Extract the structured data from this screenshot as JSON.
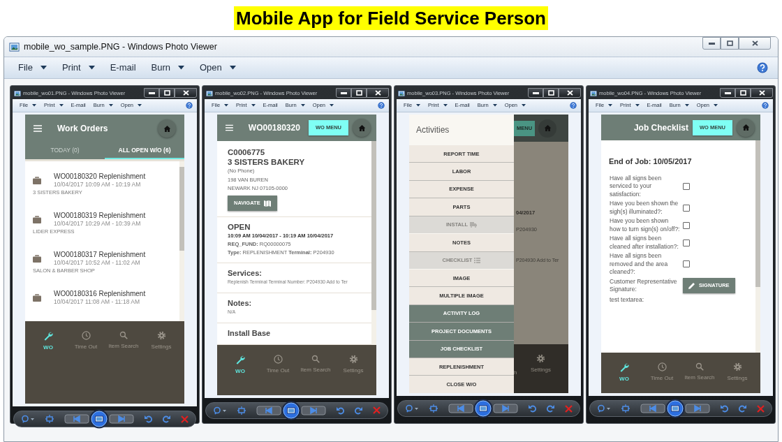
{
  "banner": "Mobile App for Field Service Person",
  "window": {
    "title": "mobile_wo_sample.PNG - Windows Photo Viewer"
  },
  "menu": [
    {
      "label": "File",
      "dropdown": true
    },
    {
      "label": "Print",
      "dropdown": true
    },
    {
      "label": "E-mail",
      "dropdown": false
    },
    {
      "label": "Burn",
      "dropdown": true
    },
    {
      "label": "Open",
      "dropdown": true
    }
  ],
  "viewers": [
    {
      "title": "mobile_wo01.PNG - Windows Photo Viewer",
      "menu": [
        {
          "label": "File",
          "dropdown": true
        },
        {
          "label": "Print",
          "dropdown": true
        },
        {
          "label": "E-mail",
          "dropdown": false
        },
        {
          "label": "Burn",
          "dropdown": true
        },
        {
          "label": "Open",
          "dropdown": true
        }
      ],
      "screen": {
        "kind": "work_orders",
        "title": "Work Orders",
        "tabs": [
          {
            "label": "TODAY (0)",
            "selected": false
          },
          {
            "label": "ALL OPEN W/O (6)",
            "selected": true
          }
        ],
        "orders": [
          {
            "title": "WO00180320 Replenishment",
            "time": "10/04/2017 10:09 AM - 10:19 AM",
            "customer": "3 SISTERS BAKERY"
          },
          {
            "title": "WO00180319 Replenishment",
            "time": "10/04/2017 10:29 AM - 10:39 AM",
            "customer": "LIDER EXPRESS"
          },
          {
            "title": "WO00180317 Replenishment",
            "time": "10/04/2017 10:52 AM - 11:02 AM",
            "customer": "SALON & BARBER SHOP"
          },
          {
            "title": "WO00180316 Replenishment",
            "time": "10/04/2017 11:08 AM - 11:18 AM"
          }
        ],
        "nav": [
          {
            "label": "WO",
            "selected": true
          },
          {
            "label": "Time Out",
            "selected": false
          },
          {
            "label": "Item Search",
            "selected": false
          },
          {
            "label": "Settings",
            "selected": false
          }
        ]
      }
    },
    {
      "title": "mobile_wo02.PNG - Windows Photo Viewer",
      "menu": [
        {
          "label": "File",
          "dropdown": true
        },
        {
          "label": "Print",
          "dropdown": true
        },
        {
          "label": "E-mail",
          "dropdown": false
        },
        {
          "label": "Burn",
          "dropdown": true
        },
        {
          "label": "Open",
          "dropdown": true
        }
      ],
      "screen": {
        "kind": "wo_detail",
        "title": "WO00180320",
        "menu_button": "WO MENU",
        "customer": {
          "id": "C0006775",
          "name": "3 SISTERS BAKERY",
          "lines": [
            "(No Phone)",
            "198 VAN BUREN",
            "NEWARK NJ 07105-0000"
          ],
          "navigate": "NAVIGATE"
        },
        "status": {
          "heading": "OPEN",
          "time": "10:09 AM 10/04/2017 - 10:19 AM 10/04/2017",
          "fund": "**REQ_FUND:** RQ00000075",
          "type": "**Type:** REPLENISHMENT **Terminal:** P204930"
        },
        "sections": [
          {
            "heading": "Services:",
            "text": "Replenish Terminal Terminal Number: P204930 Add to Ter"
          },
          {
            "heading": "Notes:",
            "text": "N/A"
          },
          {
            "heading": "Install Base"
          }
        ],
        "nav": [
          {
            "label": "WO",
            "selected": true
          },
          {
            "label": "Time Out",
            "selected": false
          },
          {
            "label": "Item Search",
            "selected": false
          },
          {
            "label": "Settings",
            "selected": false
          }
        ]
      }
    },
    {
      "title": "mobile_wo03.PNG - Windows Photo Viewer",
      "menu": [
        {
          "label": "File",
          "dropdown": true
        },
        {
          "label": "Print",
          "dropdown": true
        },
        {
          "label": "E-mail",
          "dropdown": false
        },
        {
          "label": "Burn",
          "dropdown": true
        },
        {
          "label": "Open",
          "dropdown": true
        }
      ],
      "screen": {
        "kind": "activities",
        "drawer_title": "Activities",
        "actions": [
          {
            "label": "REPORT TIME",
            "kind": "normal"
          },
          {
            "label": "LABOR",
            "kind": "normal"
          },
          {
            "label": "EXPENSE",
            "kind": "normal"
          },
          {
            "label": "PARTS",
            "kind": "normal"
          },
          {
            "label": "INSTALL",
            "kind": "disabled"
          },
          {
            "label": "NOTES",
            "kind": "normal"
          },
          {
            "label": "CHECKLIST",
            "kind": "disabled"
          },
          {
            "label": "IMAGE",
            "kind": "normal"
          },
          {
            "label": "MULTIPLE IMAGE",
            "kind": "normal"
          },
          {
            "label": "ACTIVITY LOG",
            "kind": "primary"
          },
          {
            "label": "PROJECT DOCUMENTS",
            "kind": "primary"
          },
          {
            "label": "JOB CHECKLIST",
            "kind": "primary"
          },
          {
            "label": "REPLENISHMENT",
            "kind": "normal"
          },
          {
            "label": "CLOSE W/O",
            "kind": "normal"
          }
        ],
        "behind": {
          "button": "MENU",
          "texts": [
            "04/2017",
            "P204930",
            "P204930 Add to Ter"
          ],
          "nav": [
            "h",
            "Settings"
          ]
        }
      }
    },
    {
      "title": "mobile_wo04.PNG - Windows Photo Viewer",
      "menu": [
        {
          "label": "File",
          "dropdown": true
        },
        {
          "label": "Print",
          "dropdown": true
        },
        {
          "label": "E-mail",
          "dropdown": false
        },
        {
          "label": "Burn",
          "dropdown": true
        },
        {
          "label": "Open",
          "dropdown": true
        }
      ],
      "screen": {
        "kind": "job_checklist",
        "title": "Job Checklist",
        "menu_button": "WO MENU",
        "heading": "End of Job: 10/05/2017",
        "questions": [
          {
            "text": "Have all signs been serviced to your satisfaction:",
            "checked": false
          },
          {
            "text": "Have you been shown the sigh(s) illuminated?:",
            "checked": false
          },
          {
            "text": "Have you been shown how to turn sign(s) on/off?:",
            "checked": false
          },
          {
            "text": "Have all signs been cleaned after installation?:",
            "checked": false
          },
          {
            "text": "Have all signs been removed and the area cleaned?:",
            "checked": false
          }
        ],
        "signature": {
          "label": "Customer Representative Signature:",
          "button": "SIGNATURE"
        },
        "textarea_label": "test textarea:",
        "nav": [
          {
            "label": "WO",
            "selected": true
          },
          {
            "label": "Time Out",
            "selected": false
          },
          {
            "label": "Item Search",
            "selected": false
          },
          {
            "label": "Settings",
            "selected": false
          }
        ]
      }
    }
  ]
}
